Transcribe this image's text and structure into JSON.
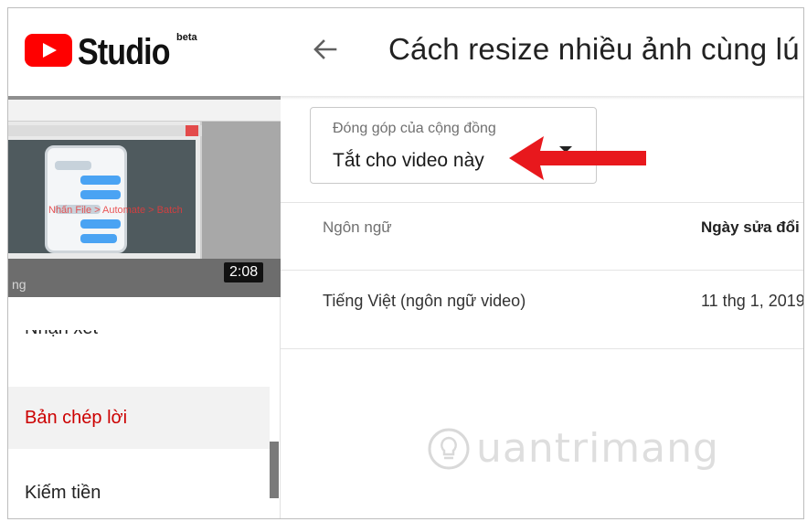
{
  "app": {
    "logo_text": "Studio",
    "logo_badge": "beta"
  },
  "header": {
    "title": "Cách resize nhiều ảnh cùng lú"
  },
  "video": {
    "duration": "2:08",
    "overlay_text": "Nhấn File > Automate > Batch",
    "caption_fragment": "ng"
  },
  "sidebar": {
    "items": [
      {
        "label": "Nhận xét",
        "state": "partially-visible"
      },
      {
        "label": "Bản chép lời",
        "state": "active"
      },
      {
        "label": "Kiếm tiền",
        "state": "normal"
      }
    ]
  },
  "dropdown": {
    "label": "Đóng góp của cộng đồng",
    "value": "Tắt cho video này"
  },
  "table": {
    "headers": [
      "Ngôn ngữ",
      "Ngày sửa đổi"
    ],
    "rows": [
      [
        "Tiếng Việt (ngôn ngữ video)",
        "11 thg 1, 2019"
      ]
    ]
  },
  "watermark": {
    "text": "uantrimang"
  },
  "colors": {
    "brand_red": "#ff0000",
    "active_text": "#cc0000",
    "arrow_red": "#e8181d"
  },
  "icons": {
    "back": "left-arrow-icon",
    "dropdown": "caret-down-icon",
    "annotation": "red-arrow-icon",
    "watermark": "lightbulb-icon"
  }
}
